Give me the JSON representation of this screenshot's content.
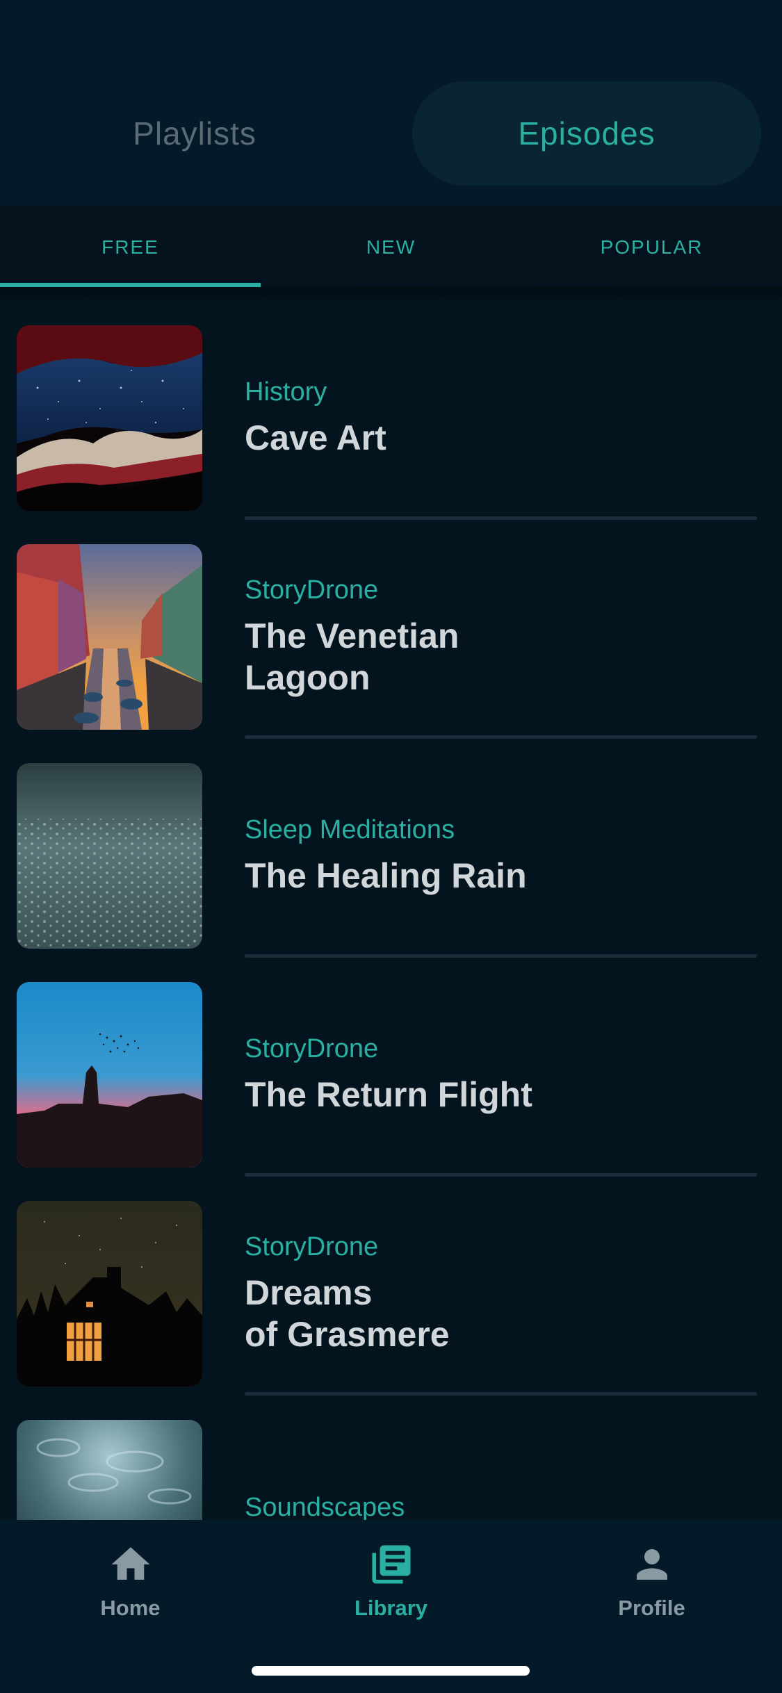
{
  "segments": {
    "playlists": "Playlists",
    "episodes": "Episodes",
    "selected": "Episodes"
  },
  "subtabs": {
    "items": [
      "FREE",
      "NEW",
      "POPULAR"
    ],
    "selected": "FREE"
  },
  "episodes": [
    {
      "category": "History",
      "title": "Cave Art",
      "image": "cave-starry-sky"
    },
    {
      "category": "StoryDrone",
      "title": "The Venetian\nLagoon",
      "image": "venice-canal-sunset"
    },
    {
      "category": "Sleep Meditations",
      "title": "The Healing Rain",
      "image": "raindrops-surface"
    },
    {
      "category": "StoryDrone",
      "title": "The Return Flight",
      "image": "birds-dusk-silhouette"
    },
    {
      "category": "StoryDrone",
      "title": "Dreams\nof Grasmere",
      "image": "cottage-night-stars"
    },
    {
      "category": "Soundscapes",
      "title": "",
      "image": "water-ripples"
    }
  ],
  "nav": {
    "items": [
      {
        "label": "Home",
        "icon": "home-icon"
      },
      {
        "label": "Library",
        "icon": "library-icon"
      },
      {
        "label": "Profile",
        "icon": "profile-icon"
      }
    ],
    "selected": "Library"
  },
  "colors": {
    "accent": "#2ab0a2",
    "background": "#04141f",
    "header": "#051a28",
    "title_text": "#d0d6d9",
    "inactive": "#5b6b74"
  }
}
